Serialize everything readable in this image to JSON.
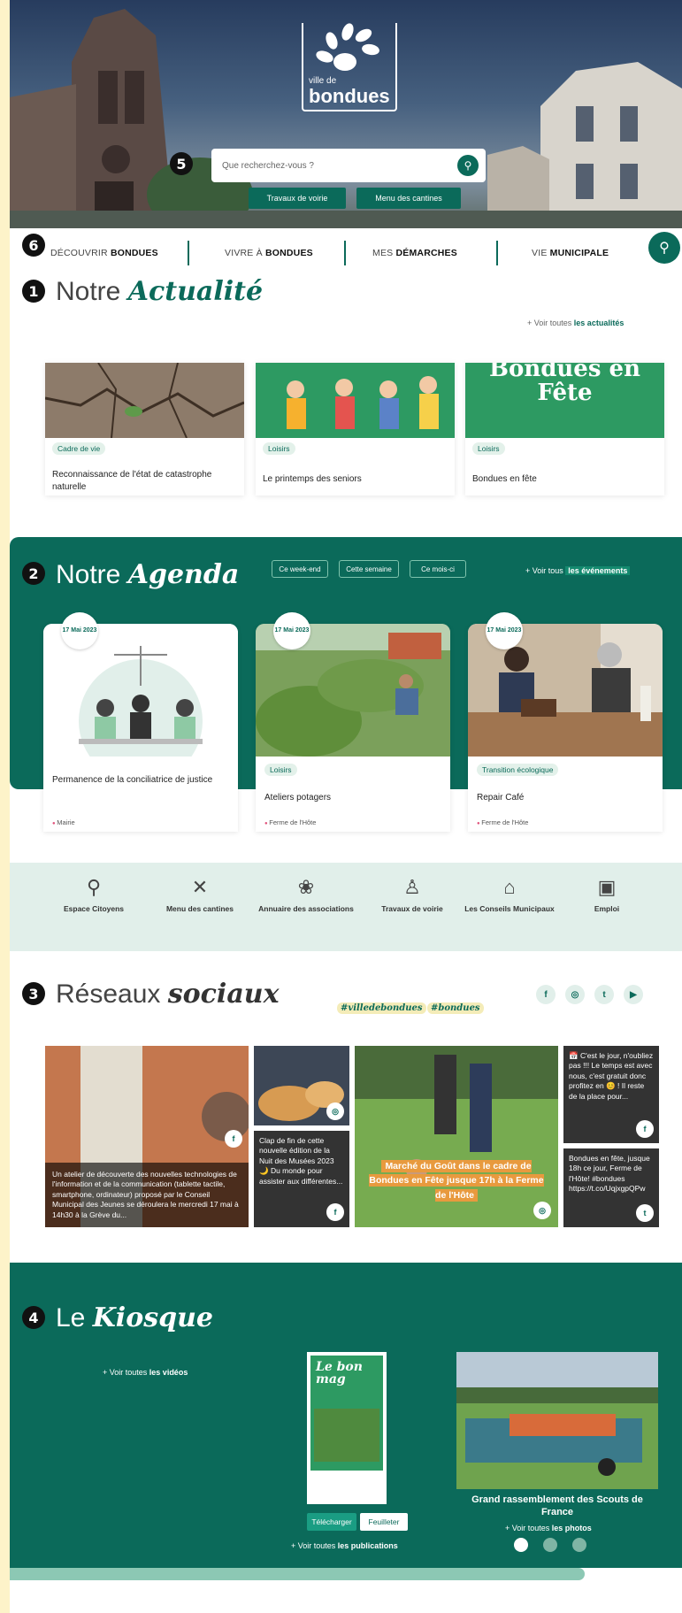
{
  "hero": {
    "logo_small": "ville de",
    "logo_big": "bondues",
    "search_placeholder": "Que recherchez-vous ?",
    "quick_links": [
      "Travaux de voirie",
      "Menu des cantines"
    ]
  },
  "nav": {
    "items": [
      {
        "light": "DÉCOUVRIR ",
        "bold": "BONDUES"
      },
      {
        "light": "VIVRE À ",
        "bold": "BONDUES"
      },
      {
        "light": "MES ",
        "bold": "DÉMARCHES"
      },
      {
        "light": "VIE ",
        "bold": "MUNICIPALE"
      }
    ]
  },
  "markers": [
    "1",
    "2",
    "3",
    "4",
    "5",
    "6"
  ],
  "news": {
    "title_plain": "Notre ",
    "title_script": "Actualité",
    "see_all_prefix": "+ Voir toutes ",
    "see_all_bold": "les actualités",
    "cards": [
      {
        "tag": "Cadre de vie",
        "title": "Reconnaissance de l'état de catastrophe naturelle"
      },
      {
        "tag": "Loisirs",
        "title": "Le printemps des seniors"
      },
      {
        "tag": "Loisirs",
        "title": "Bondues en fête",
        "image_text": "Bondues en Fête"
      }
    ]
  },
  "agenda": {
    "title_plain": "Notre ",
    "title_script": "Agenda",
    "filters": [
      "Ce week-end",
      "Cette semaine",
      "Ce mois-ci"
    ],
    "see_all_prefix": "+ Voir tous ",
    "see_all_bold": "les événements",
    "events": [
      {
        "date": "17 Mai 2023",
        "tag": "",
        "title": "Permanence de la conciliatrice de justice",
        "location": "Mairie"
      },
      {
        "date": "17 Mai 2023",
        "tag": "Loisirs",
        "title": "Ateliers potagers",
        "location": "Ferme de l'Hôte"
      },
      {
        "date": "17 Mai 2023",
        "tag": "Transition écologique",
        "title": "Repair Café",
        "location": "Ferme de l'Hôte"
      }
    ]
  },
  "shortcuts": [
    {
      "icon": "citizen-space-icon",
      "label": "Espace Citoyens"
    },
    {
      "icon": "cutlery-icon",
      "label": "Menu des cantines"
    },
    {
      "icon": "association-icon",
      "label": "Annuaire des associations"
    },
    {
      "icon": "roadwork-icon",
      "label": "Travaux de voirie"
    },
    {
      "icon": "townhall-icon",
      "label": "Les Conseils Municipaux"
    },
    {
      "icon": "briefcase-icon",
      "label": "Emploi"
    }
  ],
  "social": {
    "title_plain": "Réseaux ",
    "title_script": "sociaux",
    "hashtags": [
      "#villedebondues",
      "#bondues"
    ],
    "networks": [
      "f",
      "◎",
      "t",
      "▶"
    ],
    "posts": [
      {
        "text": "Un atelier de découverte des nouvelles technologies de l'information et de la communication (tablette tactile, smartphone, ordinateur) proposé par le Conseil Municipal des Jeunes se déroulera le mercredi 17 mai à 14h30 à la Grève du...",
        "badge": "f"
      },
      {
        "text": "",
        "badge": "◎"
      },
      {
        "text": "Clap de fin de cette nouvelle édition de la Nuit des Musées 2023 🌙 Du monde pour assister aux différentes...",
        "badge": "f"
      },
      {
        "text": "Marché du Goût dans le cadre de Bondues en Fête jusque 17h à la Ferme de l'Hôte",
        "badge": "◎"
      },
      {
        "text": "📅 C'est le jour, n'oubliez pas !!! Le temps est avec nous, c'est gratuit donc profitez en 😊 ! Il reste de la place pour...",
        "badge": "f"
      },
      {
        "text": "Bondues en fête, jusque 18h ce jour, Ferme de l'Hôte! #bondues https://t.co/UqjxgpQPw",
        "badge": "t"
      }
    ]
  },
  "kiosk": {
    "title_plain": "Le ",
    "title_script": "Kiosque",
    "videos_prefix": "+ Voir toutes ",
    "videos_bold": "les vidéos",
    "mag_title": "Le bon mag",
    "btn_download": "Télécharger",
    "btn_browse": "Feuilleter",
    "pubs_prefix": "+ Voir toutes ",
    "pubs_bold": "les publications",
    "photo_title": "Grand rassemblement des Scouts de France",
    "photos_prefix": "+ Voir toutes ",
    "photos_bold": "les photos"
  },
  "colors": {
    "accent": "#0b6a5a",
    "light": "#e1efea",
    "highlight": "#f4ecb8",
    "margin": "#fdf3c9"
  }
}
